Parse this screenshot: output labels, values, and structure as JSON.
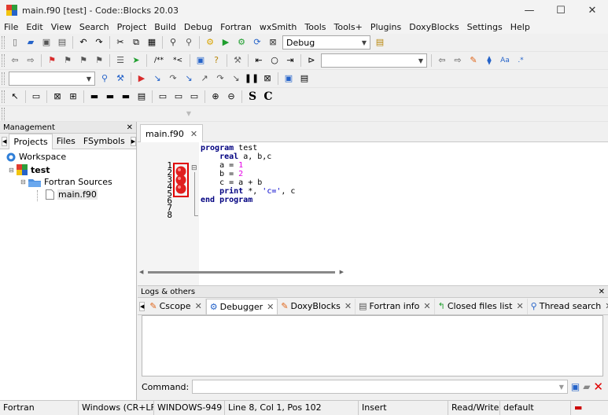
{
  "window": {
    "title": "main.f90 [test] - Code::Blocks 20.03"
  },
  "menu": [
    "File",
    "Edit",
    "View",
    "Search",
    "Project",
    "Build",
    "Debug",
    "Fortran",
    "wxSmith",
    "Tools",
    "Tools+",
    "Plugins",
    "DoxyBlocks",
    "Settings",
    "Help"
  ],
  "toolbar": {
    "build_target": "Debug",
    "search_combo": "",
    "symbols_combo": ""
  },
  "toolbar4": {
    "s_label": "S",
    "c_label": "C"
  },
  "management": {
    "title": "Management",
    "tabs": [
      "Projects",
      "Files",
      "FSymbols"
    ],
    "tree": {
      "workspace": "Workspace",
      "project": "test",
      "folder": "Fortran Sources",
      "file": "main.f90"
    }
  },
  "editor": {
    "tab": "main.f90",
    "line_numbers": [
      "1",
      "2",
      "3",
      "4",
      "5",
      "6",
      "7",
      "8"
    ],
    "breakpoint_lines": [
      4,
      5,
      6
    ]
  },
  "logs": {
    "title": "Logs & others",
    "tabs": [
      "Cscope",
      "Debugger",
      "DoxyBlocks",
      "Fortran info",
      "Closed files list",
      "Thread search"
    ],
    "command_label": "Command:"
  },
  "status": {
    "lang": "Fortran",
    "eol": "Windows (CR+LF)",
    "encoding": "WINDOWS-949",
    "position": "Line 8, Col 1, Pos 102",
    "mode": "Insert",
    "access": "Read/Write",
    "profile": "default"
  },
  "colors": {
    "keyword": "#000080",
    "number": "#e400e4",
    "breakpoint": "#e02020",
    "highlight_box": "#e00000"
  }
}
